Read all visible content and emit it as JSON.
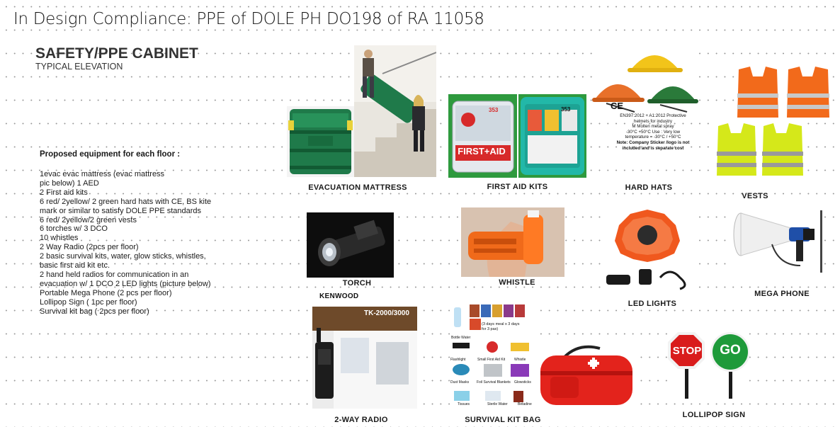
{
  "slide": {
    "title": "In Design Compliance: PPE of DOLE PH DO198 of RA 11058"
  },
  "cabinet": {
    "title": "SAFETY/PPE CABINET",
    "subtitle": "TYPICAL ELEVATION"
  },
  "equipment": {
    "heading": "Proposed equipment for each floor :",
    "items": [
      "1evac evac mattress (evac mattress",
      "pic below)  1 AED",
      "2 First aid kits",
      "6 red/ 2yellow/ 2 green hard hats with CE, BS kite",
      "mark or similar to satisfy DOLE  PPE standards",
      "6 red/ 2yellow/2 green vests",
      "6 torches w/ 3 DCO",
      "10 whistles",
      "2 Way Radio (2pcs per floor)",
      "2 basic survival kits, water, glow sticks, whistles,",
      "basic first aid kit  etc.",
      "2 hand held radios for communication in an",
      "evacuation w/ 1 DCO  2 LED lights (picture below)",
      "Portable Mega Phone (2 pcs per floor)",
      "Lollipop Sign ( 1pc per floor)",
      "Survival kit bag ( 2pcs per floor)"
    ]
  },
  "captions": {
    "evac": "EVACUATION MATTRESS",
    "firstaid": "FIRST AID KITS",
    "hardhats": "HARD HATS",
    "vests": "VESTS",
    "torch": "TORCH",
    "whistle": "WHISTLE",
    "led": "LED LIGHTS",
    "megaphone": "MEGA PHONE",
    "radio": "2-WAY RADIO",
    "survival": "SURVIVAL KIT BAG",
    "lollipop": "LOLLIPOP SIGN"
  },
  "image_text": {
    "firstaid_banner": "FIRST+AID",
    "firstaid_count": "353",
    "hardhat_ce": "CE",
    "hardhat_note_1": "EN397:2012 + A1:2012 Protective",
    "hardhat_note_2": "helmets for industry",
    "hardhat_note_3": "M  Molten metal spray",
    "hardhat_note_4": "-30°C +50°C Use : Very low",
    "hardhat_note_5": "temperature = -30°C / +50°C",
    "hardhat_note_6": "Note: Company Sticker /logo is not",
    "hardhat_note_7": "included and is separate cost",
    "radio_brand": "KENWOOD",
    "radio_model": "TK-2000/3000",
    "sign_stop": "STOP",
    "sign_go": "GO",
    "survival_note": "(3 days meal x 3 days for 3 pax)",
    "survival_water": "Bottle Water",
    "survival_flashlight": "Flashlight",
    "survival_firstaid": "Small First Aid Kit",
    "survival_whistle": "Whistle",
    "survival_mask": "Dust Masks",
    "survival_blankets": "Foil Survival Blankets",
    "survival_glow": "Glowsticks",
    "survival_tissues": "Tissues",
    "survival_sterile": "Sterile Water",
    "survival_betadine": "Betadine"
  },
  "colors": {
    "evac_green": "#1f7a4a",
    "firstaid_red": "#d72a2a",
    "vest_orange": "#f26a1b",
    "vest_yellow": "#d5e81a",
    "hat_yellow": "#f2c41a",
    "hat_orange": "#e8702a",
    "hat_green": "#2a7a3a",
    "led_orange": "#f0581e",
    "stop_red": "#d91c1c",
    "go_green": "#1e9a3a"
  }
}
